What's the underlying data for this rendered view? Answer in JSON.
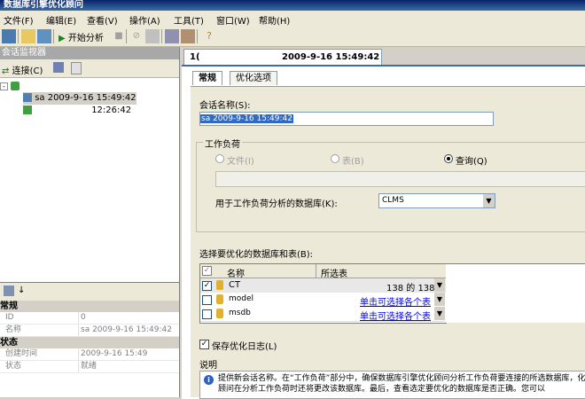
{
  "window": {
    "title": "数据库引擎优化顾问"
  },
  "menu": [
    "文件(F)",
    "编辑(E)",
    "查看(V)",
    "操作(A)",
    "工具(T)",
    "窗口(W)",
    "帮助(H)"
  ],
  "toolbar": {
    "start_analysis": "开始分析"
  },
  "session_monitor": {
    "title": "会话监视器",
    "connect_label": "连接(C)",
    "sessions": [
      "sa 2009-9-16 15:49:42",
      "12:26:42"
    ]
  },
  "properties": {
    "categories": [
      {
        "name": "常规",
        "rows": [
          {
            "key": "ID",
            "value": "0"
          },
          {
            "key": "名称",
            "value": "sa 2009-9-16 15:49:42"
          }
        ]
      },
      {
        "name": "状态",
        "rows": [
          {
            "key": "创建时间",
            "value": "2009-9-16 15:49"
          },
          {
            "key": "状态",
            "value": "就绪"
          }
        ]
      }
    ]
  },
  "document_tab": {
    "title": "2009-9-16 15:49:42",
    "prefix": "1("
  },
  "subtabs": {
    "general": "常规",
    "tuning_options": "优化选项"
  },
  "session": {
    "name_label": "会话名称(S):",
    "name_value": "sa 2009-9-16 15:49:42"
  },
  "workload": {
    "group_label": "工作负荷",
    "option_file": "文件(I)",
    "option_table": "表(B)",
    "option_query": "查询(Q)",
    "selected": "查询(Q)",
    "db_label": "用于工作负荷分析的数据库(K):",
    "db_value": "CLMS"
  },
  "db_section": {
    "label": "选择要优化的数据库和表(B):",
    "columns": [
      "名称",
      "所选表"
    ],
    "rows": [
      {
        "name": "CT",
        "checked": true,
        "selected": "138 的 138",
        "link": false
      },
      {
        "name": "model",
        "checked": false,
        "selected": "单击可选择各个表",
        "link": true
      },
      {
        "name": "msdb",
        "checked": false,
        "selected": "单击可选择各个表",
        "link": true
      }
    ]
  },
  "save_log": {
    "label": "保存优化日志(L)",
    "checked": true
  },
  "description": {
    "label": "说明",
    "text": "提供新会话名称。在“工作负荷”部分中，确保数据库引擎优化顾问分析工作负荷要连接的所选数据库，化顾问在分析工作负荷时还将更改该数据库。最后，查看选定要优化的数据库是否正确。您可以"
  },
  "colors": {
    "accent": "#3a6ea5",
    "title_bar": "#0a246a",
    "link": "#0000ee"
  }
}
